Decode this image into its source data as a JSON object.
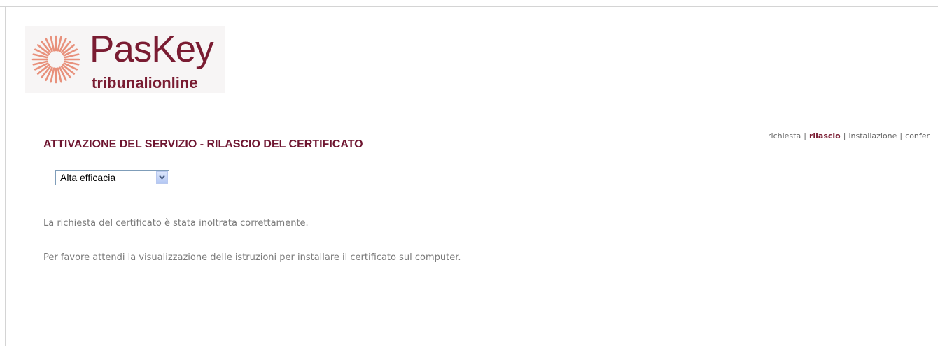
{
  "logo": {
    "title": "PasKey",
    "subtitle": "tribunalionline",
    "brand_color": "#7a1c32",
    "ray_color": "#e8917c"
  },
  "steps": [
    {
      "label": "richiesta",
      "active": false
    },
    {
      "label": "rilascio",
      "active": true
    },
    {
      "label": "installazione",
      "active": false
    },
    {
      "label": "confer",
      "active": false
    }
  ],
  "separator": "|",
  "main": {
    "title": "ATTIVAZIONE DEL SERVIZIO - RILASCIO DEL CERTIFICATO",
    "select": {
      "value": "Alta efficacia"
    },
    "message1": "La richiesta del certificato è stata inoltrata correttamente.",
    "message2": "Per favore attendi la visualizzazione delle istruzioni per installare il certificato sul computer."
  }
}
